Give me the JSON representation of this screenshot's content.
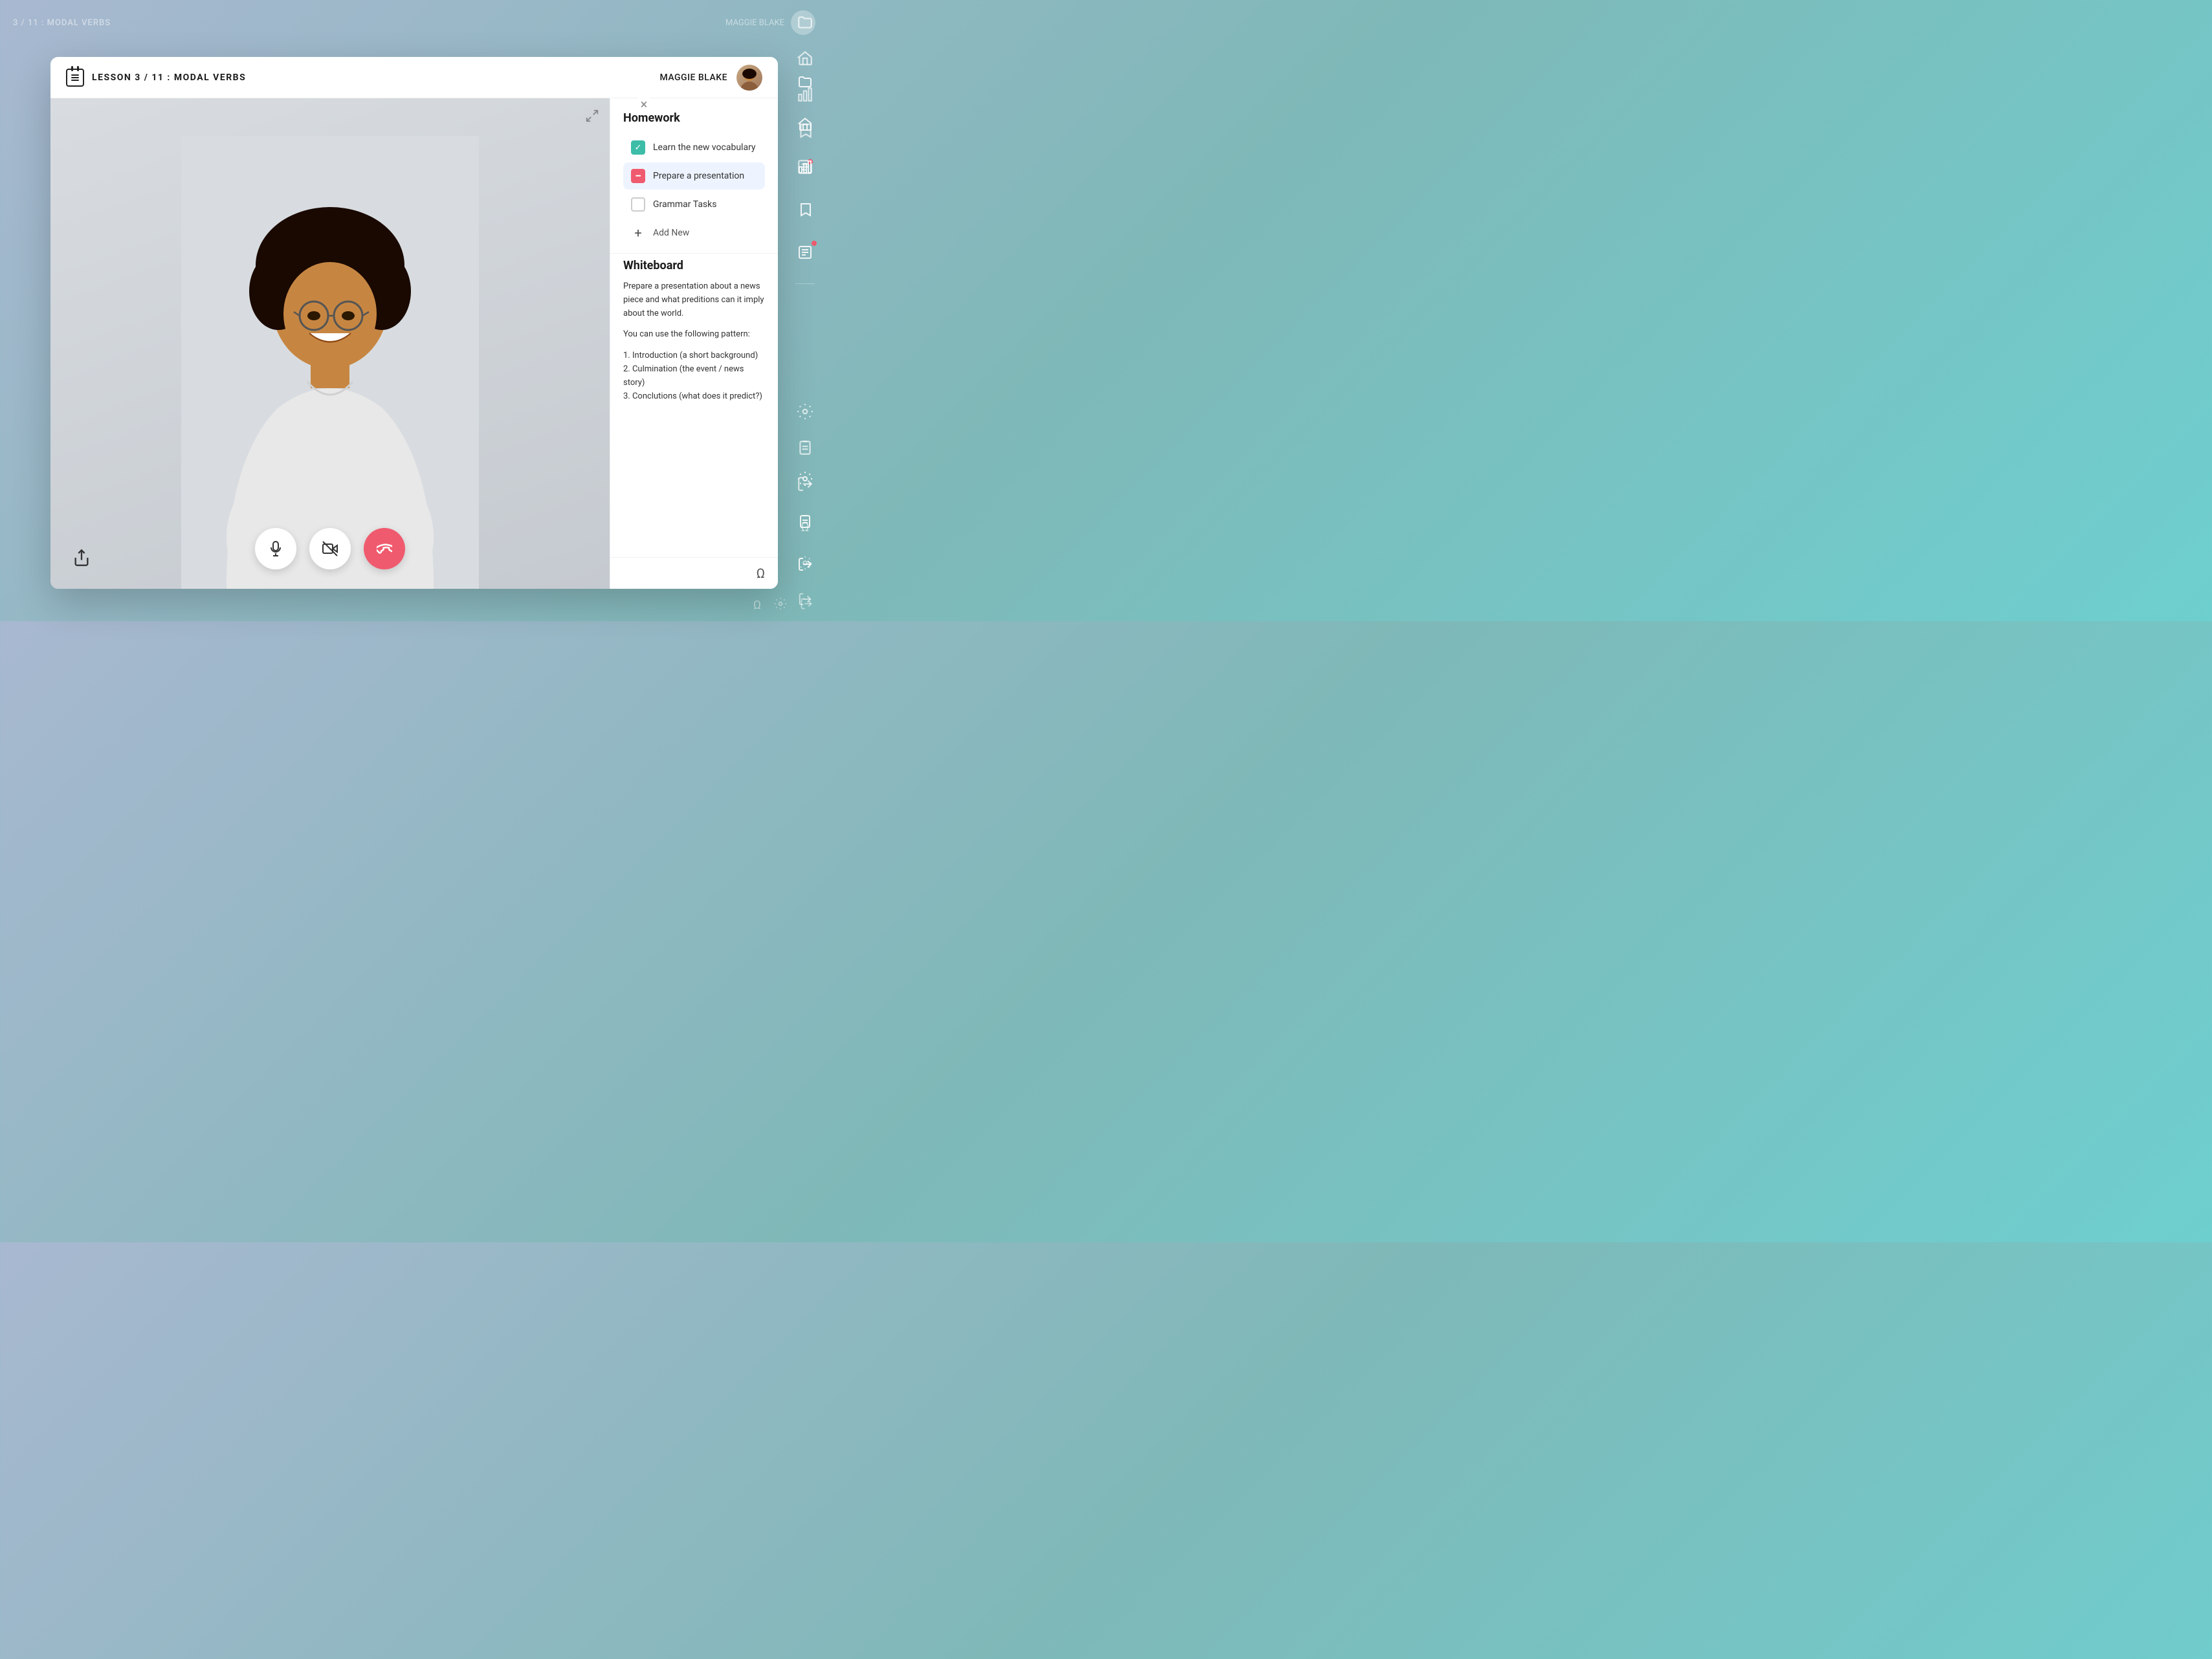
{
  "app": {
    "bg_title": "3 / 11 : MODAL VERBS",
    "bg_user": "MAGGIE BLAKE"
  },
  "header": {
    "lesson_label": "LESSON 3 / 11 : MODAL VERBS",
    "user_name": "MAGGIE BLAKE"
  },
  "homework": {
    "section_title": "Homework",
    "items": [
      {
        "id": 1,
        "text": "Learn the new vocabulary",
        "state": "checked"
      },
      {
        "id": 2,
        "text": "Prepare a presentation",
        "state": "minus",
        "active": true
      },
      {
        "id": 3,
        "text": "Grammar Tasks",
        "state": "empty"
      }
    ],
    "add_label": "Add New"
  },
  "whiteboard": {
    "section_title": "Whiteboard",
    "paragraphs": [
      "Prepare a presentation about a news piece and what preditions can it imply about the world.",
      "You can use the following pattern:",
      "1. Introduction (a short background)\n2. Culmination (the event / news story)\n3. Conclutions (what does it predict?)"
    ]
  },
  "sidebar": {
    "icons": [
      {
        "name": "folder-icon",
        "symbol": "📁"
      },
      {
        "name": "home-icon",
        "symbol": "🏠"
      },
      {
        "name": "chart-icon",
        "symbol": "📊"
      },
      {
        "name": "bookmark-icon",
        "symbol": "🔖"
      },
      {
        "name": "document-icon",
        "symbol": "📄"
      },
      {
        "name": "notes-icon",
        "symbol": "📋",
        "badge": true
      },
      {
        "name": "settings-icon",
        "symbol": "⚙️"
      },
      {
        "name": "clipboard-icon",
        "symbol": "📋"
      },
      {
        "name": "exit-icon",
        "symbol": "🚪"
      }
    ]
  },
  "controls": {
    "mic_label": "Microphone",
    "video_label": "Video",
    "end_label": "End Call"
  },
  "panel_bottom": {
    "omega_symbol": "Ω"
  }
}
